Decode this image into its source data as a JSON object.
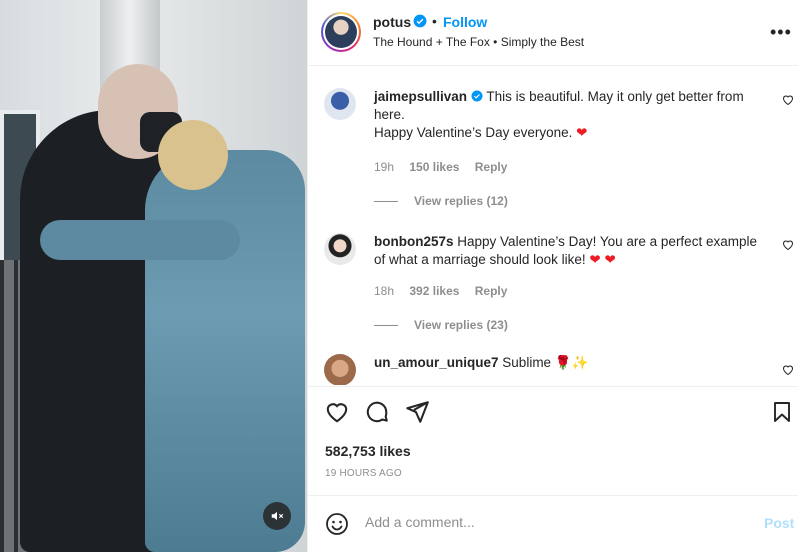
{
  "post": {
    "image_alt": "photo"
  },
  "header": {
    "username": "potus",
    "separator": "•",
    "follow_label": "Follow",
    "subtitle": "The Hound + The Fox • Simply the Best",
    "more_label": "•••"
  },
  "comments": [
    {
      "username": "jaimepsullivan",
      "verified": true,
      "text": "This is beautiful. May it only get better from here.",
      "text2": "Happy Valentine’s Day everyone.",
      "emoji": "❤",
      "time": "19h",
      "likes": "150 likes",
      "reply_label": "Reply",
      "view_replies": "View replies (12)"
    },
    {
      "username": "bonbon257s",
      "verified": false,
      "text": "Happy Valentine’s Day! You are a perfect example of what a marriage should look like!",
      "emoji": "❤ ❤",
      "time": "18h",
      "likes": "392 likes",
      "reply_label": "Reply",
      "view_replies": "View replies (23)"
    },
    {
      "username": "un_amour_unique7",
      "verified": false,
      "text": "Sublime",
      "emoji": "🌹✨"
    }
  ],
  "footer": {
    "likes": "582,753 likes",
    "posted": "19 HOURS AGO",
    "comment_placeholder": "Add a comment...",
    "post_label": "Post"
  },
  "colors": {
    "link_blue": "#0095f6",
    "post_disabled": "#b2dffc",
    "heart_red": "#ed1c24",
    "muted_text": "#8e8e8e"
  }
}
